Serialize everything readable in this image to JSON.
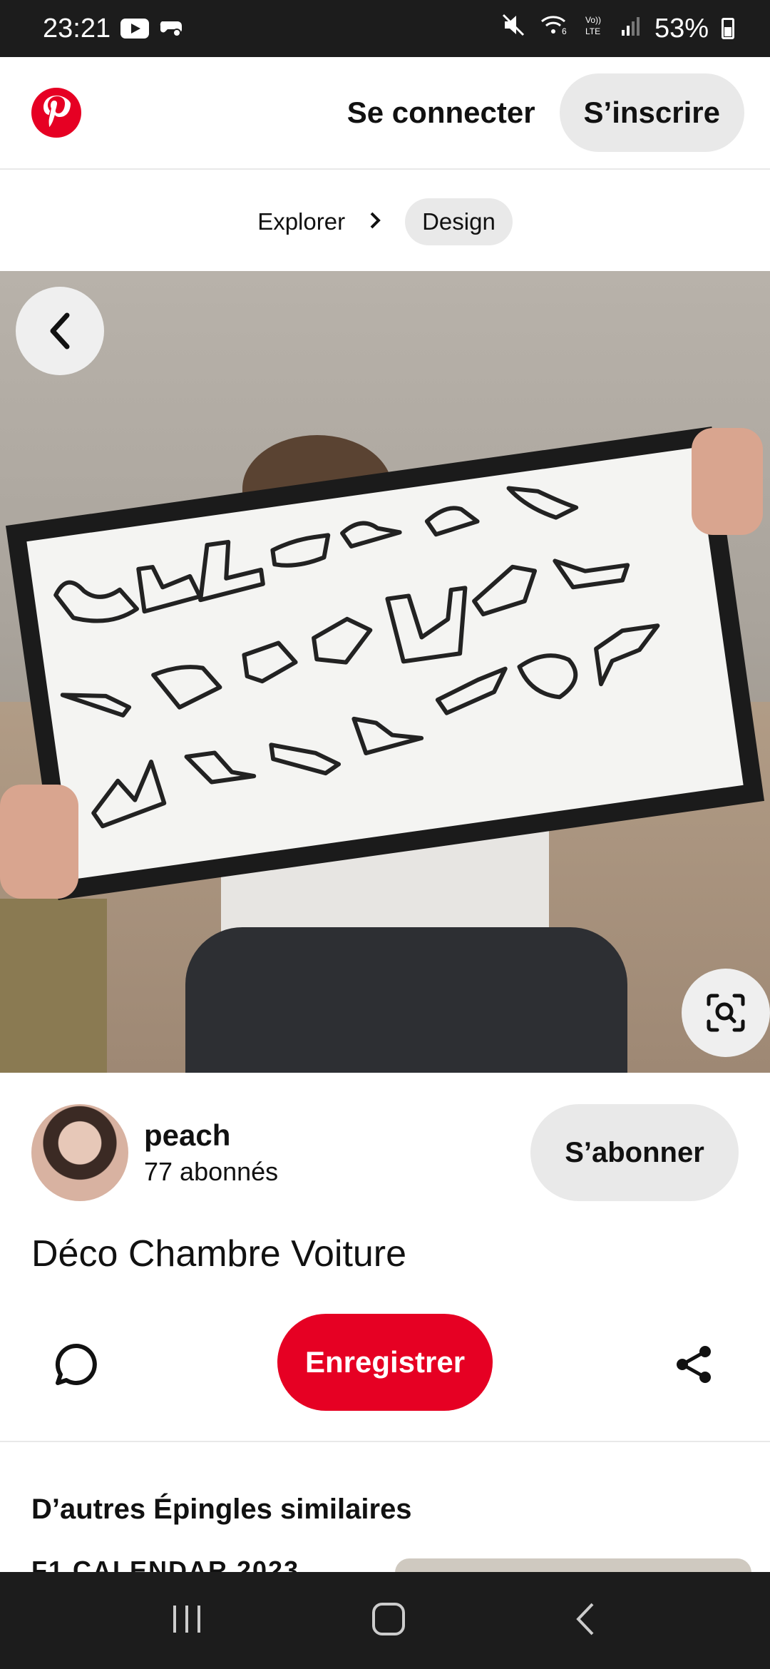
{
  "status_bar": {
    "time": "23:21",
    "battery": "53%",
    "icons": [
      "youtube-icon",
      "game-icon",
      "mute-icon",
      "wifi-calling-icon",
      "volte-icon",
      "signal-icon",
      "battery-icon"
    ]
  },
  "header": {
    "logo": "pinterest-logo",
    "login_label": "Se connecter",
    "signup_label": "S’inscrire"
  },
  "breadcrumb": {
    "items": [
      "Explorer",
      "Design"
    ]
  },
  "creator": {
    "name": "peach",
    "followers": "77 abonnés",
    "follow_label": "S’abonner"
  },
  "pin": {
    "title": "Déco Chambre Voiture",
    "save_label": "Enregistrer"
  },
  "more": {
    "title": "D’autres Épingles similaires",
    "preview_left_text": "F1 CALENDAR 2023"
  },
  "colors": {
    "brand": "#e60023",
    "button_bg": "#e9e9e9",
    "bar_bg": "#1c1c1c"
  }
}
